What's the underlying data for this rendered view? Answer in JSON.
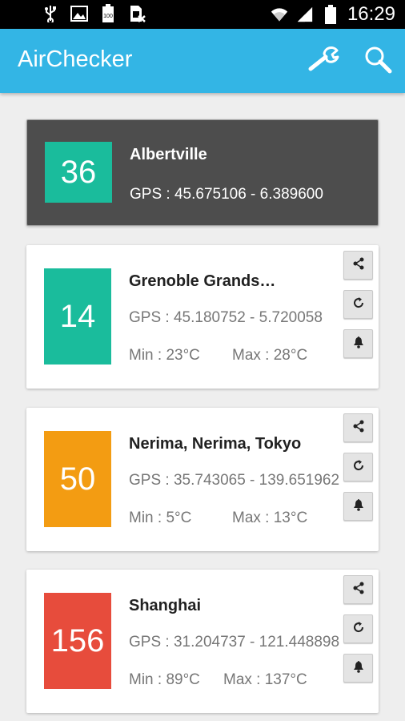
{
  "status_bar": {
    "time": "16:29",
    "icons": [
      "usb-icon",
      "image-icon",
      "battery-100-icon",
      "sim-off-icon",
      "wifi-icon",
      "signal-icon",
      "battery-icon"
    ]
  },
  "app_bar": {
    "title": "AirChecker",
    "color": "#33b5e5",
    "actions": [
      "wrench-icon",
      "search-icon"
    ]
  },
  "cards": [
    {
      "aqi": "36",
      "aqi_color": "#1abc9c",
      "city": "Albertville",
      "gps": "GPS : 45.675106 - 6.389600",
      "selected": true
    },
    {
      "aqi": "14",
      "aqi_color": "#1abc9c",
      "city": "Grenoble Grands…",
      "gps": "GPS : 45.180752 - 5.720058",
      "min": "Min : 23°C",
      "max": "Max : 28°C",
      "actions": [
        "share-icon",
        "refresh-icon",
        "bell-icon"
      ]
    },
    {
      "aqi": "50",
      "aqi_color": "#f39c12",
      "city": "Nerima, Nerima, Tokyo",
      "gps": "GPS : 35.743065 - 139.651962",
      "min": "Min : 5°C",
      "max": "Max : 13°C",
      "actions": [
        "share-icon",
        "refresh-icon",
        "bell-icon"
      ]
    },
    {
      "aqi": "156",
      "aqi_color": "#e74c3c",
      "city": "Shanghai",
      "gps": "GPS : 31.204737 - 121.448898",
      "min": "Min : 89°C",
      "max": "Max : 137°C",
      "actions": [
        "share-icon",
        "refresh-icon",
        "bell-icon"
      ]
    }
  ]
}
